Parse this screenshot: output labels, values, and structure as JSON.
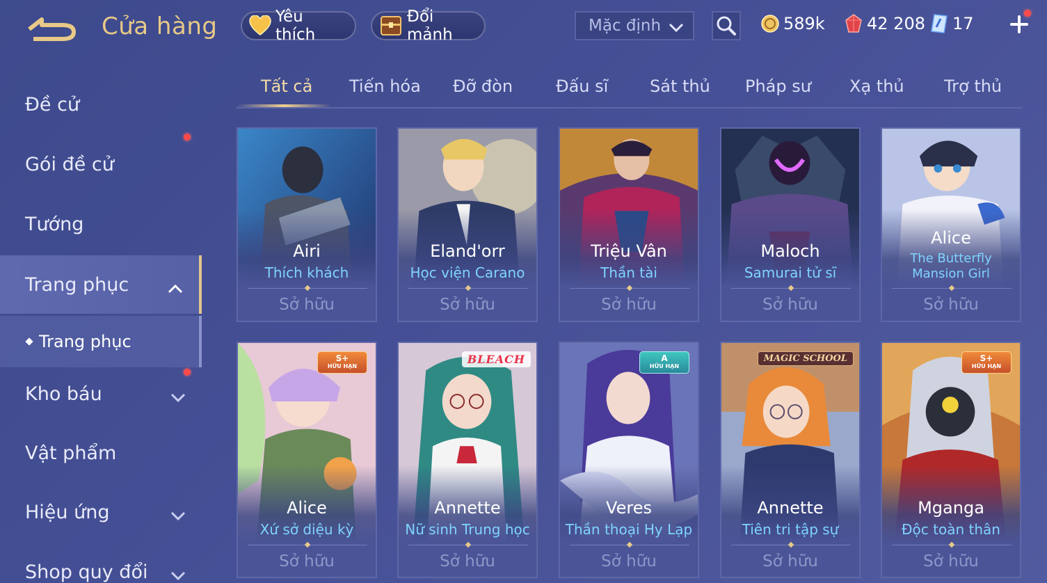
{
  "header": {
    "title": "Cửa hàng",
    "favorites_label": "Yêu thích",
    "exchange_label": "Đổi mảnh",
    "sort_value": "Mặc định",
    "currencies": {
      "gold": "589k",
      "ruby": "42 208",
      "voucher": "17"
    }
  },
  "sidebar": {
    "items": [
      {
        "label": "Đề cử"
      },
      {
        "label": "Gói đề cử"
      },
      {
        "label": "Tướng"
      },
      {
        "label": "Trang phục"
      },
      {
        "label": "Kho báu"
      },
      {
        "label": "Vật phẩm"
      },
      {
        "label": "Hiệu ứng"
      },
      {
        "label": "Shop quy đổi"
      }
    ],
    "sub_item": "Trang phục"
  },
  "tabs": [
    {
      "label": "Tất cả"
    },
    {
      "label": "Tiến hóa"
    },
    {
      "label": "Đỡ đòn"
    },
    {
      "label": "Đấu sĩ"
    },
    {
      "label": "Sát thủ"
    },
    {
      "label": "Pháp sư"
    },
    {
      "label": "Xạ thủ"
    },
    {
      "label": "Trợ thủ"
    }
  ],
  "cards": [
    {
      "hero": "Airi",
      "skin": "Thích khách",
      "status": "Sở hữu"
    },
    {
      "hero": "Eland'orr",
      "skin": "Học viện Carano",
      "status": "Sở hữu"
    },
    {
      "hero": "Triệu Vân",
      "skin": "Thần tài",
      "status": "Sở hữu"
    },
    {
      "hero": "Maloch",
      "skin": "Samurai tử sĩ",
      "status": "Sở hữu"
    },
    {
      "hero": "Alice",
      "skin": "The Butterfly Mansion Girl",
      "status": "Sở hữu"
    },
    {
      "hero": "Alice",
      "skin": "Xứ sở diệu kỳ",
      "status": "Sở hữu",
      "badge_tier": "S+",
      "badge_label": "HỮU HẠN"
    },
    {
      "hero": "Annette",
      "skin": "Nữ sinh Trung học",
      "status": "Sở hữu",
      "logo": "BLEACH"
    },
    {
      "hero": "Veres",
      "skin": "Thần thoại Hy Lạp",
      "status": "Sở hữu",
      "badge_tier": "A",
      "badge_label": "HỮU HẠN"
    },
    {
      "hero": "Annette",
      "skin": "Tiên tri tập sự",
      "status": "Sở hữu",
      "logo": "MAGIC SCHOOL"
    },
    {
      "hero": "Mganga",
      "skin": "Độc toàn thân",
      "status": "Sở hữu",
      "badge_tier": "S+",
      "badge_label": "HỮU HẠN"
    }
  ],
  "colors": {
    "accent_gold": "#e8c987",
    "skin_name_blue": "#7fd3ff",
    "notification_red": "#ff4a4a"
  },
  "icons": [
    "back-arrow-icon",
    "heart-icon",
    "chest-icon",
    "chevron-down-icon",
    "search-icon",
    "gold-coin-icon",
    "ruby-icon",
    "voucher-icon",
    "plus-icon",
    "chevron-up-icon"
  ]
}
